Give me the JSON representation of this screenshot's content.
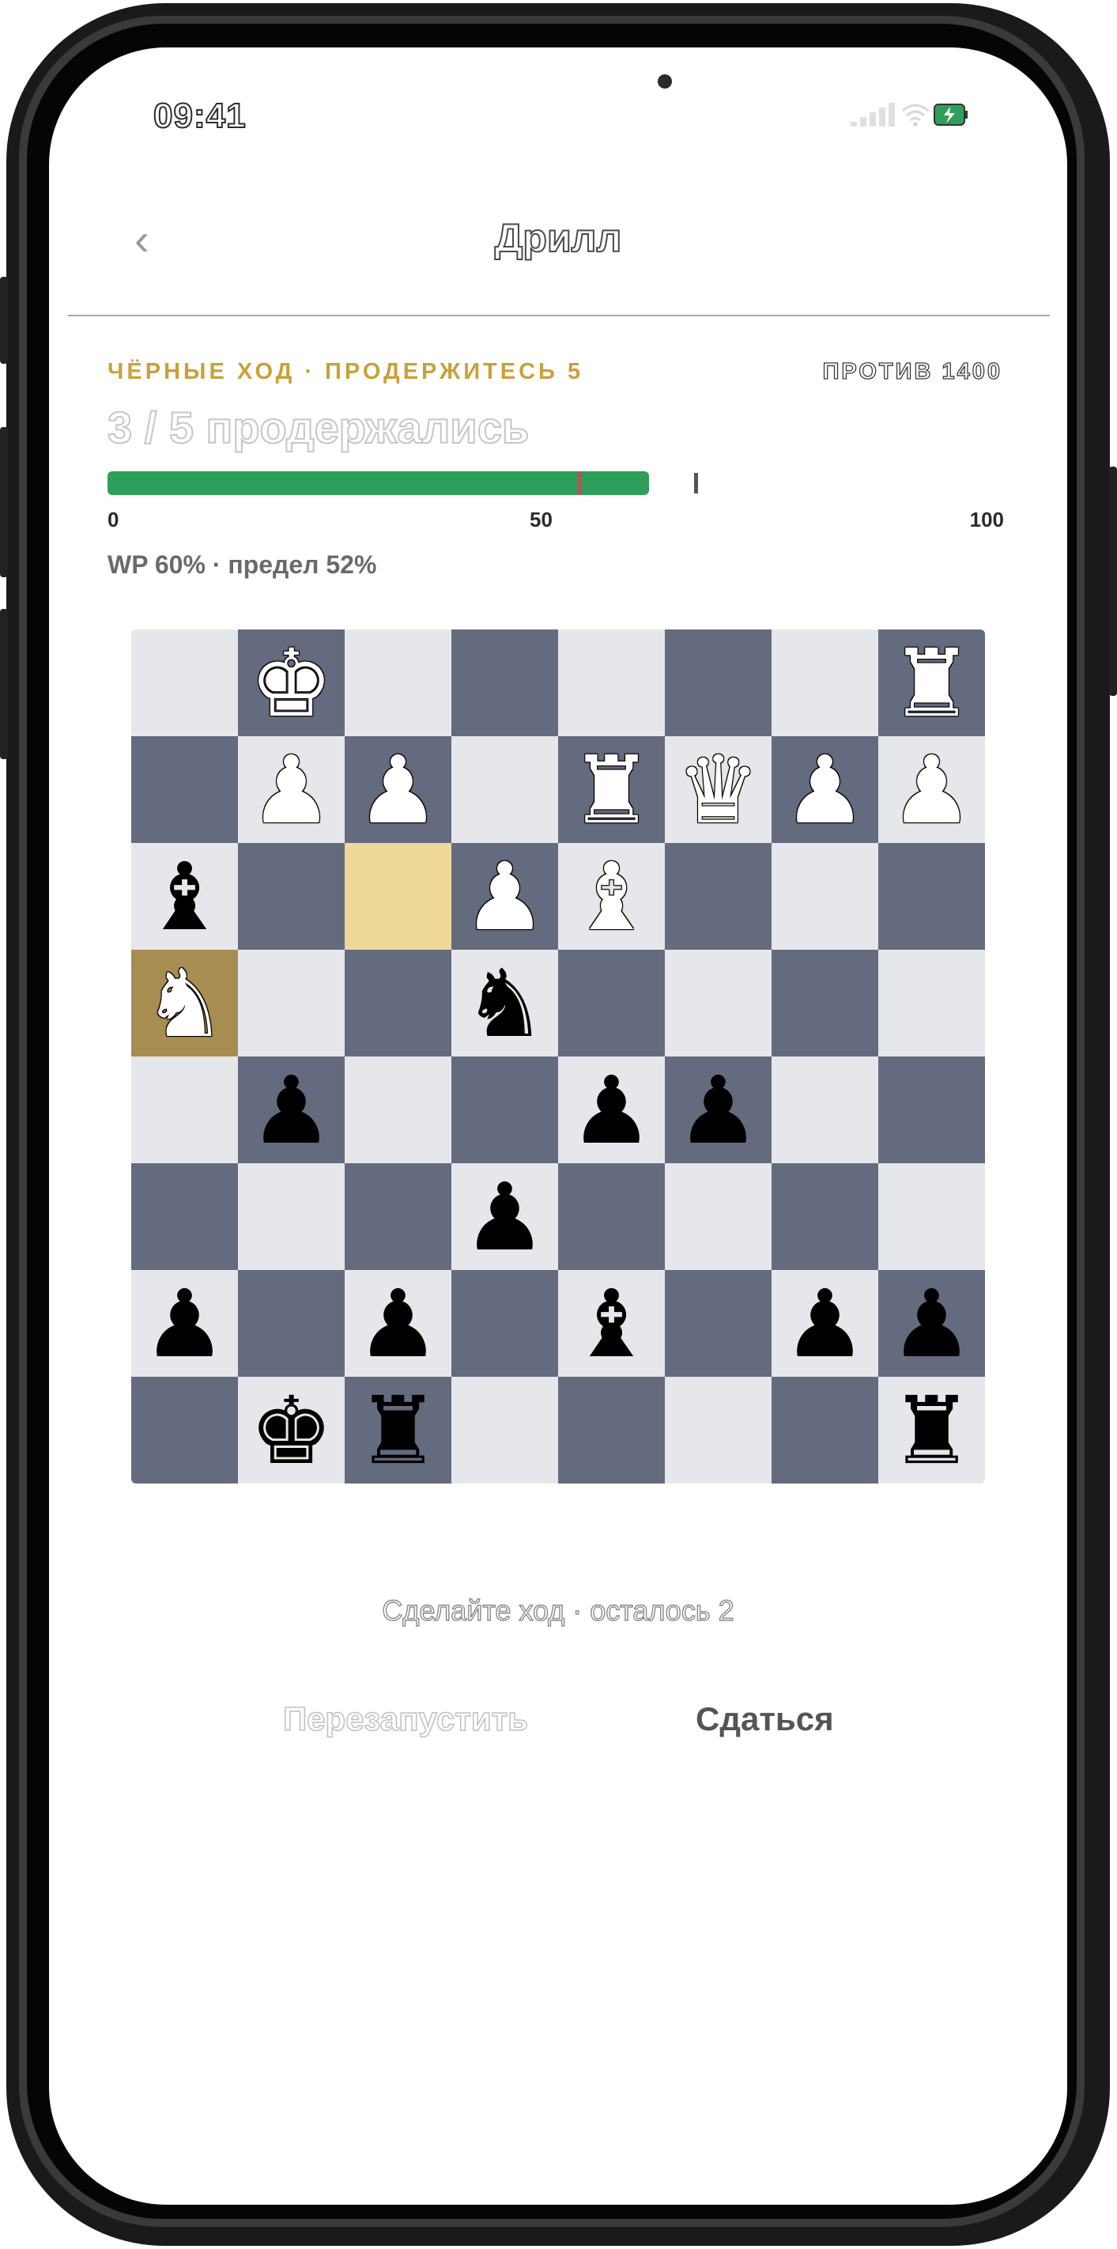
{
  "status_bar": {
    "time": "09:41"
  },
  "nav": {
    "back_label": "‹",
    "title": "Дрилл"
  },
  "drill": {
    "eyebrow": "ЧЁРНЫЕ ХОД · ПРОДЕРЖИТЕСЬ 5",
    "opponent": "ПРОТИВ 1400",
    "headline": "3 / 5 продержались",
    "wp_value": 0.6,
    "threshold": 0.52,
    "scale": {
      "min": "0",
      "mid": "50",
      "max": "100"
    },
    "wp_text": "WP 60%  · предел 52%"
  },
  "board": {
    "highlight_square": "c6",
    "selected_square": "a5",
    "rows": [
      [
        "",
        "♔",
        "",
        "",
        "",
        "",
        "",
        "♖"
      ],
      [
        "",
        "♙",
        "♙",
        "",
        "♖",
        "♕",
        "♙",
        "♙"
      ],
      [
        "♝",
        "",
        "",
        "♙",
        "♗",
        "",
        "",
        ""
      ],
      [
        "♘",
        "",
        "",
        "♞",
        "",
        "",
        "",
        ""
      ],
      [
        "",
        "♟",
        "",
        "",
        "♟",
        "♟",
        "",
        ""
      ],
      [
        "",
        "",
        "",
        "♟",
        "",
        "",
        "",
        ""
      ],
      [
        "♟",
        "",
        "♟",
        "",
        "♝",
        "",
        "♟",
        "♟"
      ],
      [
        "",
        "♚",
        "♜",
        "",
        "",
        "",
        "",
        "♜"
      ]
    ]
  },
  "footer": {
    "prompt": "Сделайте ход · осталось 2",
    "restart_label": "Перезапустить",
    "resign_label": "Сдаться"
  },
  "colors": {
    "accent": "#c8a13a",
    "progress": "#2e9e5b",
    "threshold": "#b85454",
    "board_light": "#e6e7eb",
    "board_dark": "#656b7e",
    "highlight": "#eed89a",
    "selected": "#a78d52"
  }
}
